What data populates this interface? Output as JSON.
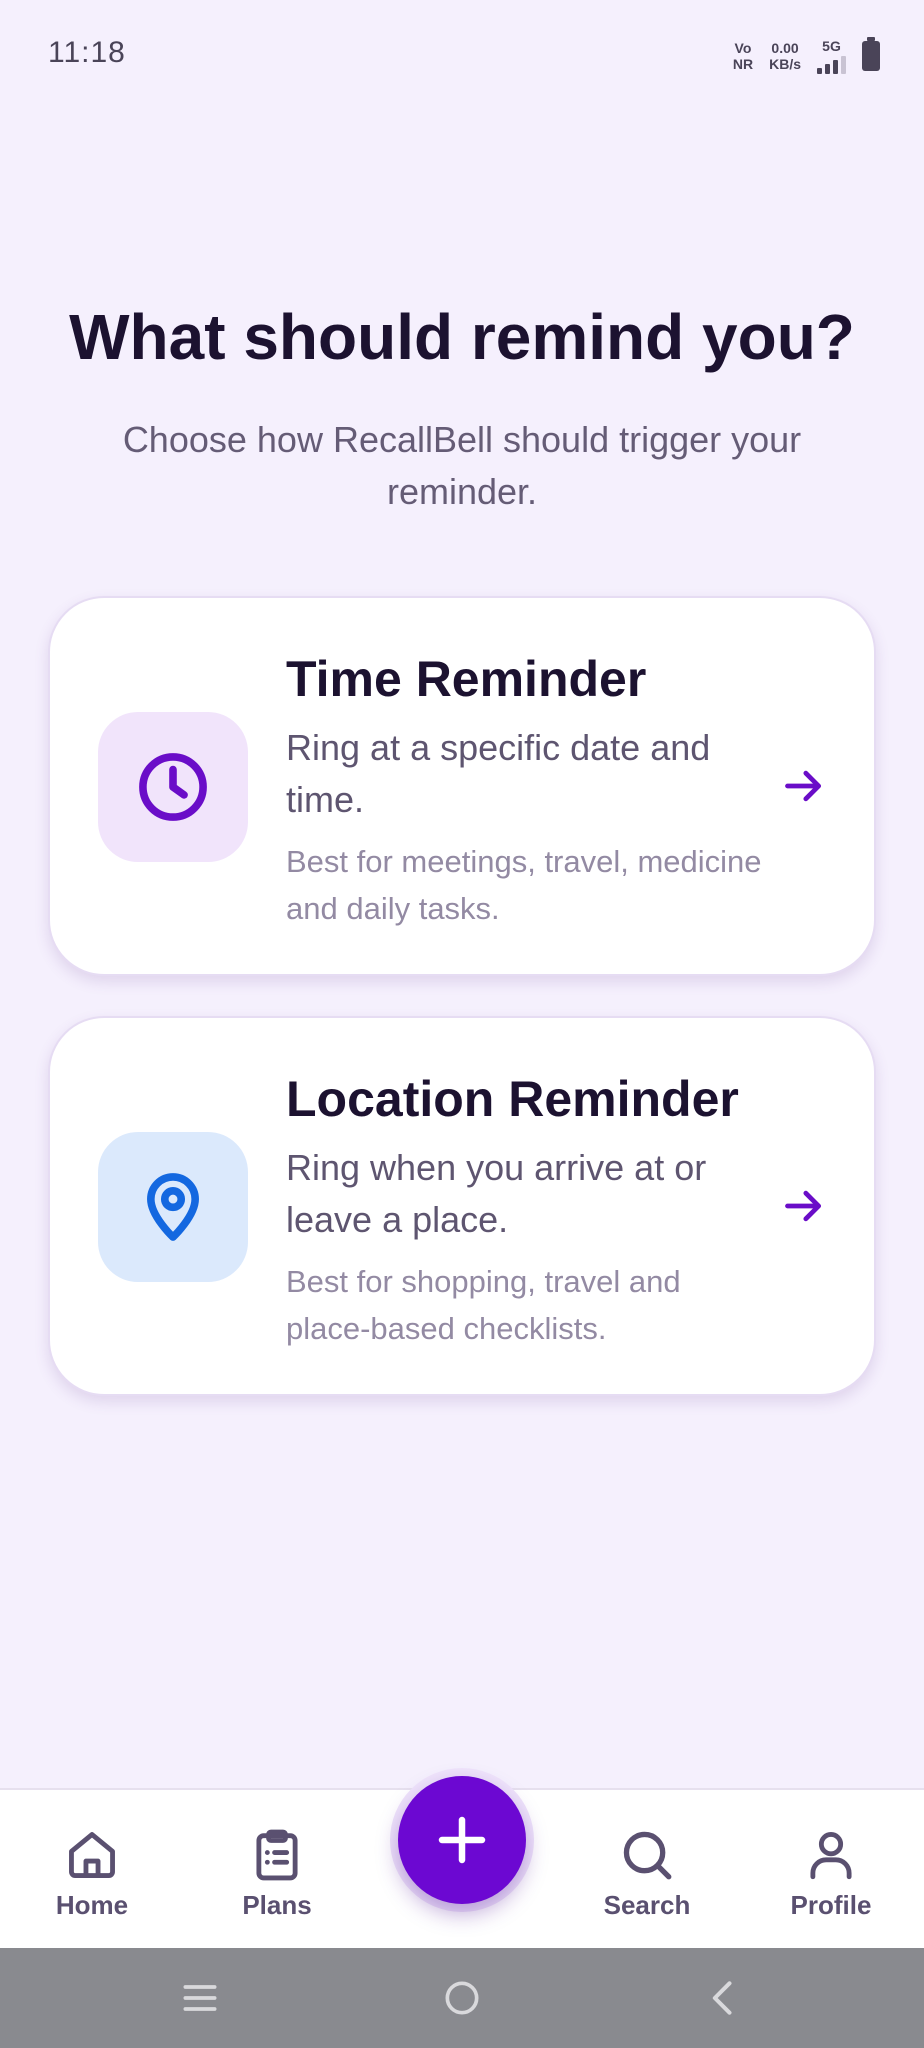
{
  "status_bar": {
    "time": "11:18",
    "net_type_top": "Vo",
    "net_type_bottom": "NR",
    "speed_value": "0.00",
    "speed_unit": "KB/s",
    "network_label": "5G",
    "signal_icon": "signal-icon",
    "battery_icon": "battery-icon"
  },
  "header": {
    "title": "What should remind you?",
    "subtitle": "Choose how RecallBell should trigger your reminder."
  },
  "options": {
    "time": {
      "icon": "clock-icon",
      "title": "Time Reminder",
      "description": "Ring at a specific date and time.",
      "note": "Best for meetings, travel, medicine and daily tasks.",
      "icon_color": "#6a0dc8",
      "icon_bg": "#f1e4fb"
    },
    "location": {
      "icon": "map-pin-icon",
      "title": "Location Reminder",
      "description": "Ring when you arrive at or leave a place.",
      "note": "Best for shopping, travel and place-based checklists.",
      "icon_color": "#1468e0",
      "icon_bg": "#dbe9fc"
    }
  },
  "bottom_nav": {
    "items": [
      {
        "label": "Home",
        "icon": "home-icon"
      },
      {
        "label": "Plans",
        "icon": "clipboard-icon"
      },
      {
        "label": "Search",
        "icon": "search-icon"
      },
      {
        "label": "Profile",
        "icon": "user-icon"
      }
    ],
    "fab_icon": "plus-icon"
  },
  "colors": {
    "accent": "#6c08d2",
    "background": "#f5f0fd",
    "title": "#1c1230",
    "nav_icon": "#5a5070"
  }
}
